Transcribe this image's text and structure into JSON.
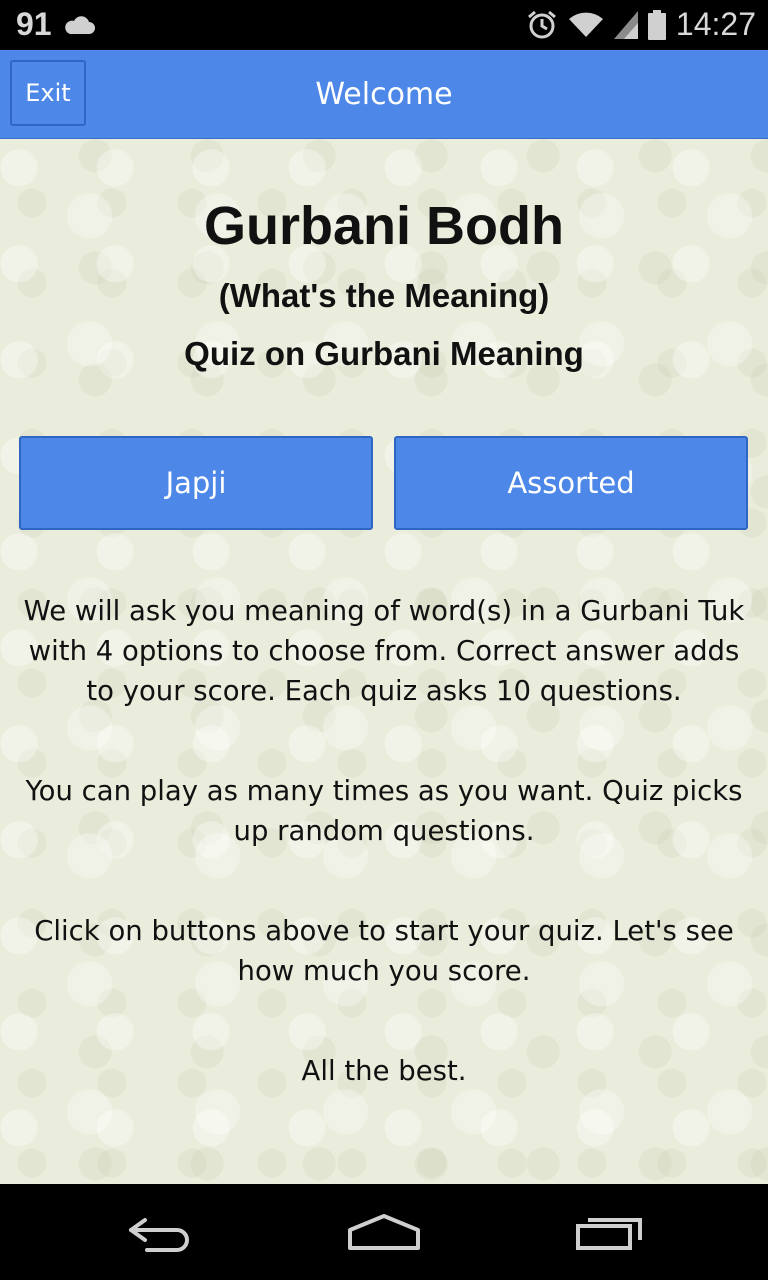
{
  "status_bar": {
    "notification_count": "91",
    "time": "14:27"
  },
  "action_bar": {
    "exit_label": "Exit",
    "title": "Welcome"
  },
  "content": {
    "title": "Gurbani Bodh",
    "subtitle": "(What's the Meaning)",
    "tagline": "Quiz on Gurbani Meaning",
    "buttons": {
      "japji": "Japji",
      "assorted": "Assorted"
    },
    "paragraphs": [
      "We will ask you meaning of word(s) in a Gurbani Tuk with 4 options to choose from. Correct answer adds to your score. Each quiz asks 10 questions.",
      "You can play as many times as you want. Quiz picks up random questions.",
      "Click on buttons above to start your quiz. Let's see how much you score.",
      "All the best."
    ]
  },
  "colors": {
    "accent": "#4d87e8",
    "accent_border": "#2f66c4",
    "background": "#ebeddc"
  },
  "icons": {
    "status_left": [
      "cloud-icon"
    ],
    "status_right": [
      "alarm-icon",
      "wifi-icon",
      "signal-icon",
      "battery-icon"
    ],
    "nav": [
      "back-icon",
      "home-icon",
      "recents-icon"
    ]
  }
}
